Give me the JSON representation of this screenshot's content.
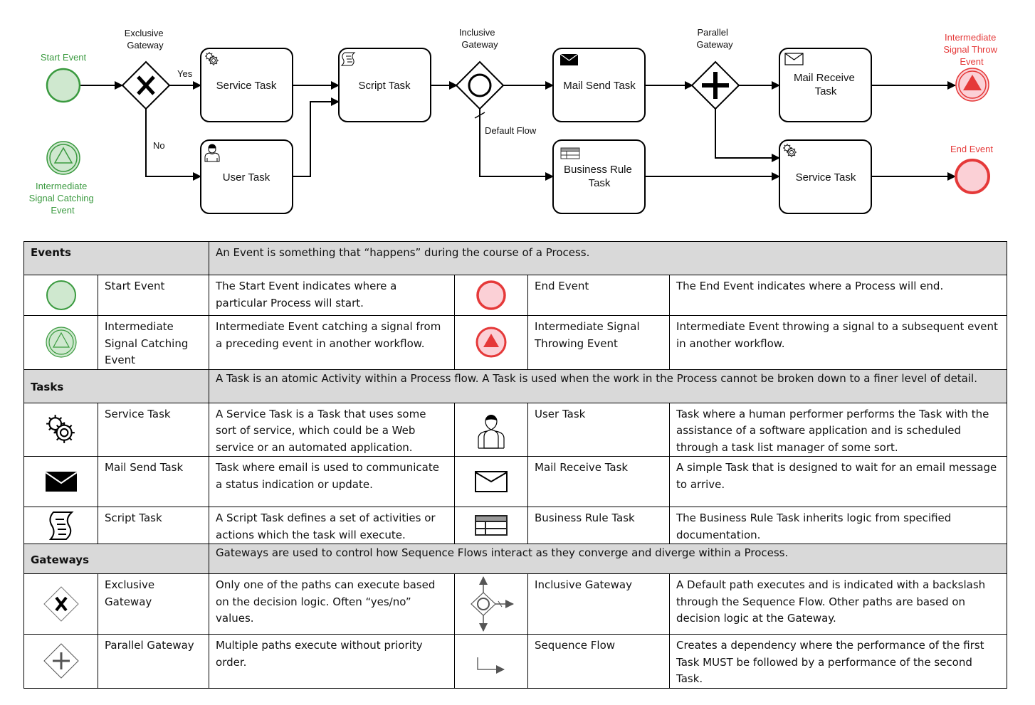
{
  "colors": {
    "start_fill": "#cfe8cf",
    "start_stroke": "#3a9a3f",
    "end_fill": "#fbd0d6",
    "end_stroke": "#e53939",
    "section_bg": "#d9d9d9",
    "line": "#000000"
  },
  "diagram": {
    "start_event": "Start Event",
    "catch_event": [
      "Intermediate",
      "Signal Catching",
      "Event"
    ],
    "exclusive_gateway": [
      "Exclusive",
      "Gateway"
    ],
    "yes_label": "Yes",
    "no_label": "No",
    "service_task_1": "Service Task",
    "user_task": "User Task",
    "script_task": "Script Task",
    "inclusive_gateway": [
      "Inclusive",
      "Gateway"
    ],
    "default_flow": "Default Flow",
    "mail_send_task": "Mail Send Task",
    "business_rule_task": [
      "Business Rule",
      "Task"
    ],
    "parallel_gateway": [
      "Parallel",
      "Gateway"
    ],
    "mail_receive_task": [
      "Mail Receive",
      "Task"
    ],
    "service_task_2": "Service Task",
    "throw_event": [
      "Intermediate",
      "Signal Throw",
      "Event"
    ],
    "end_event": "End Event"
  },
  "legend": {
    "events": {
      "title": "Events",
      "description": "An Event is something that “happens” during the course of a Process.",
      "rows": [
        {
          "left": {
            "icon": "start-event-icon",
            "name": "Start Event",
            "desc": "The Start Event indicates where a particular Process will start."
          },
          "right": {
            "icon": "end-event-icon",
            "name": "End Event",
            "desc": "The End Event indicates where a Process will end."
          }
        },
        {
          "left": {
            "icon": "signal-catch-event-icon",
            "name": "Intermediate Signal Catching Event",
            "desc": "Intermediate Event catching a signal from a preceding event in another workflow."
          },
          "right": {
            "icon": "signal-throw-event-icon",
            "name": "Intermediate Signal Throwing Event",
            "desc": "Intermediate Event throwing a signal to a subsequent event in another workflow."
          }
        }
      ]
    },
    "tasks": {
      "title": "Tasks",
      "description": "A Task is an atomic Activity within a Process flow. A Task is used when the work in the Process cannot be broken down to a finer level of detail.",
      "rows": [
        {
          "left": {
            "icon": "gears-icon",
            "name": "Service Task",
            "desc": "A Service Task is a Task that uses some sort of service, which could be a Web service or an automated application."
          },
          "right": {
            "icon": "user-icon",
            "name": "User Task",
            "desc": "Task where a human performer performs the Task with the assistance of a software application and is scheduled through a task list manager of some sort."
          }
        },
        {
          "left": {
            "icon": "envelope-filled-icon",
            "name": "Mail Send Task",
            "desc": "Task where email is used to communicate a status indication or update."
          },
          "right": {
            "icon": "envelope-outline-icon",
            "name": "Mail Receive Task",
            "desc": "A simple Task that is designed to wait for an email message to arrive."
          }
        },
        {
          "left": {
            "icon": "script-icon",
            "name": "Script Task",
            "desc": "A Script Task defines a set of activities or actions which the task will execute."
          },
          "right": {
            "icon": "table-icon",
            "name": "Business Rule Task",
            "desc": "The Business Rule Task inherits logic from specified documentation."
          }
        }
      ]
    },
    "gateways": {
      "title": "Gateways",
      "description": "Gateways are used to control how Sequence Flows interact as they converge and diverge within a Process.",
      "rows": [
        {
          "left": {
            "icon": "exclusive-gateway-icon",
            "name": "Exclusive Gateway",
            "desc": "Only one of the paths can execute based on the decision logic. Often “yes/no” values."
          },
          "right": {
            "icon": "inclusive-gateway-icon",
            "name": "Inclusive Gateway",
            "desc": "A Default path executes and is indicated with a backslash through the Sequence Flow. Other paths are based on decision logic at the Gateway."
          }
        },
        {
          "left": {
            "icon": "parallel-gateway-icon",
            "name": "Parallel Gateway",
            "desc": "Multiple paths execute without priority order."
          },
          "right": {
            "icon": "sequence-flow-icon",
            "name": "Sequence Flow",
            "desc": "Creates a dependency where the performance of the first Task MUST be followed by a performance of the second Task."
          }
        }
      ]
    }
  }
}
